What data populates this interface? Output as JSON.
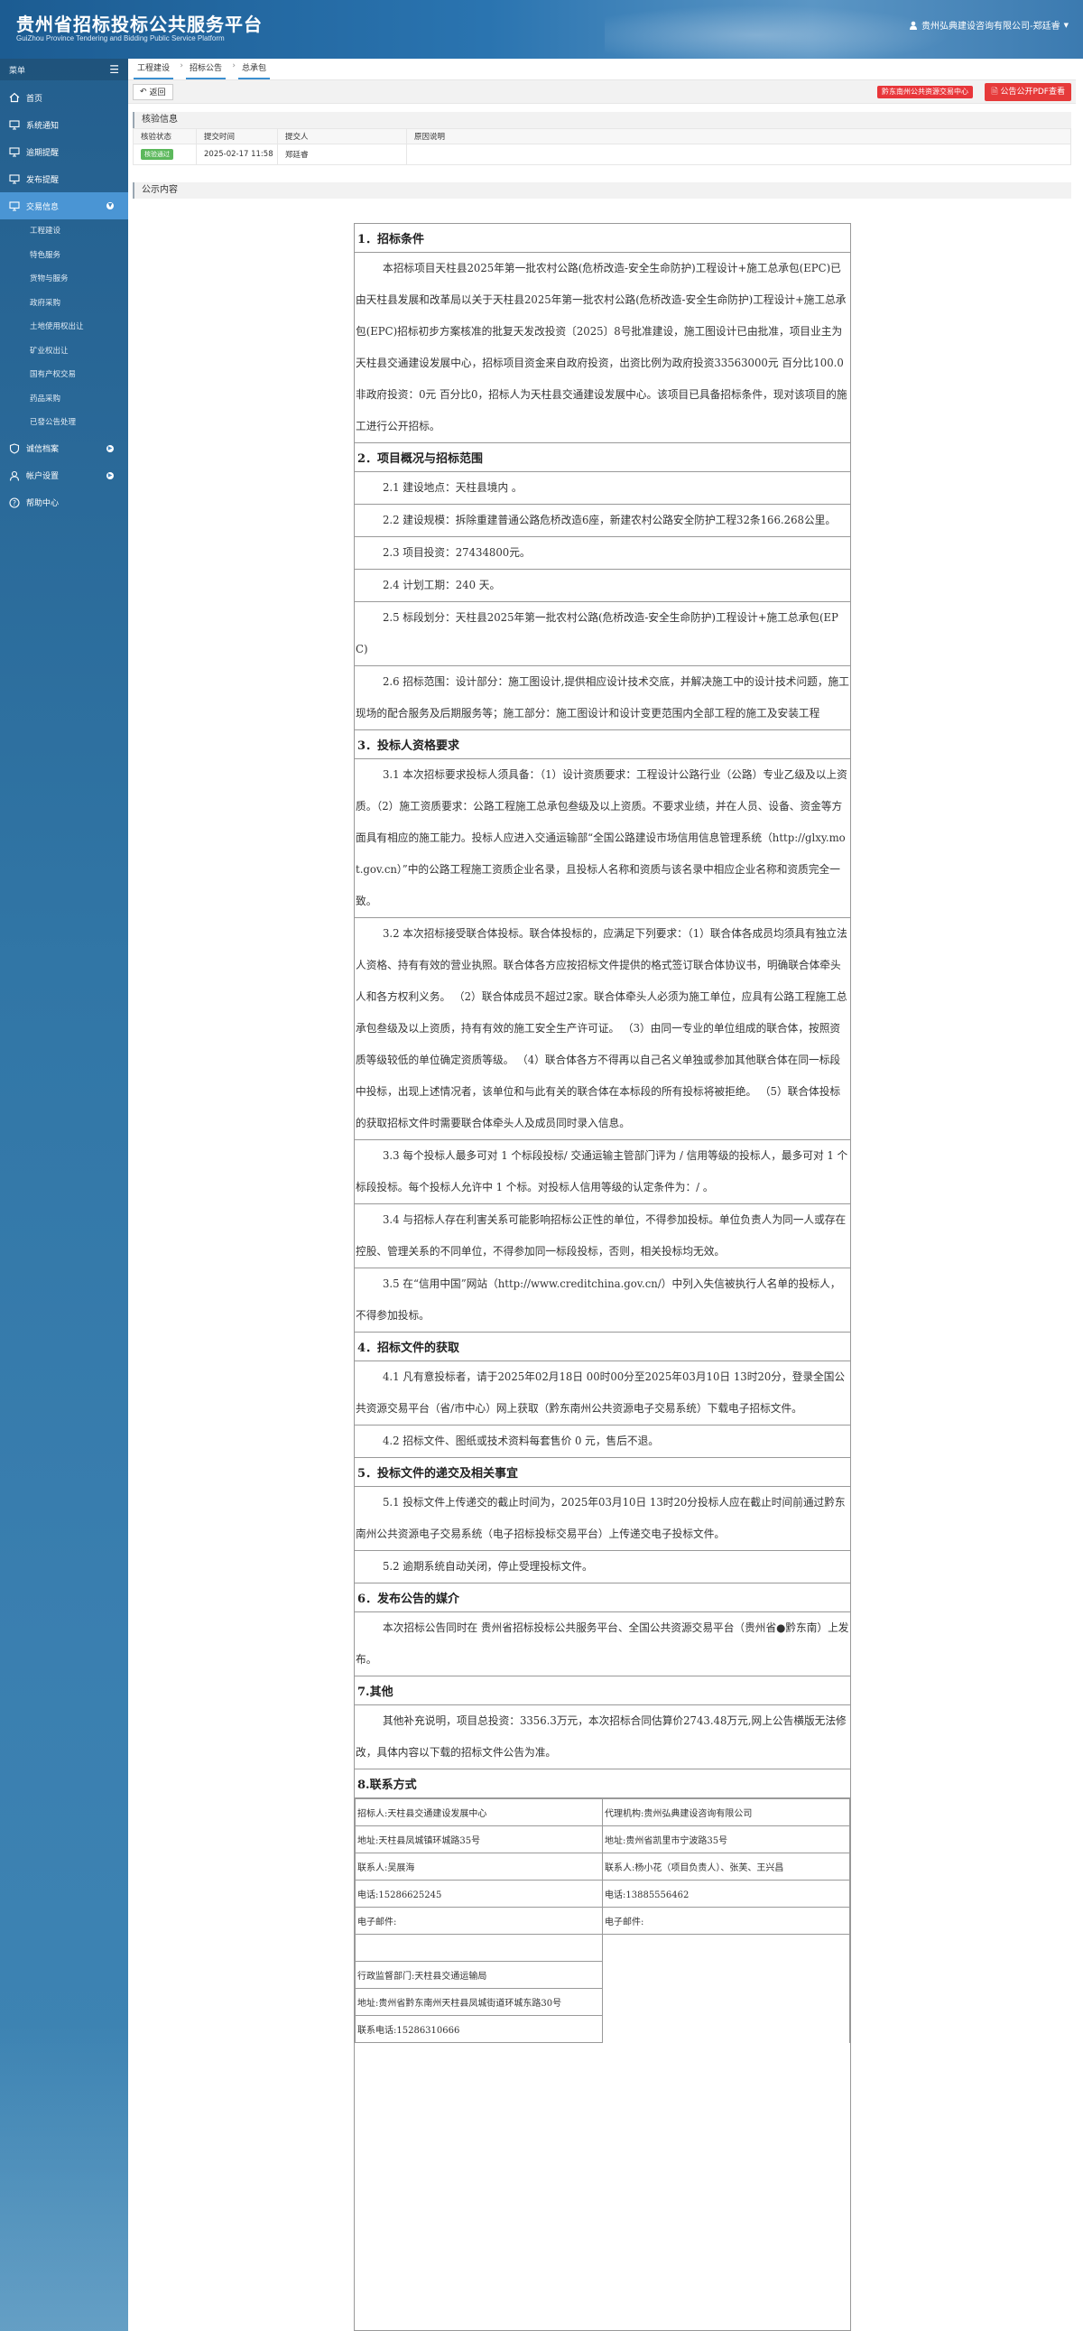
{
  "header": {
    "title": "贵州省招标投标公共服务平台",
    "subtitle": "GuiZhou Province Tendering and Bidding Public Service Platform",
    "user": "贵州弘典建设咨询有限公司-郑廷睿"
  },
  "sidebar": {
    "label": "菜单",
    "items": [
      {
        "label": "首页",
        "icon": "home-icon"
      },
      {
        "label": "系统通知",
        "icon": "monitor-icon"
      },
      {
        "label": "逾期提醒",
        "icon": "monitor-icon"
      },
      {
        "label": "发布提醒",
        "icon": "monitor-icon"
      },
      {
        "label": "交易信息",
        "icon": "monitor-icon"
      }
    ],
    "subitems": [
      "工程建设",
      "特色服务",
      "货物与服务",
      "政府采购",
      "土地使用权出让",
      "矿业权出让",
      "国有产权交易",
      "药品采购",
      "已發公告处理"
    ],
    "items2": [
      {
        "label": "诚信档案",
        "icon": "shield-icon"
      },
      {
        "label": "帐户设置",
        "icon": "user-icon"
      },
      {
        "label": "帮助中心",
        "icon": "help-icon"
      }
    ]
  },
  "breadcrumb": [
    "工程建设",
    "招标公告",
    "总承包"
  ],
  "toolbar": {
    "back": "返回",
    "center_btn": "黔东南州公共资源交易中心",
    "pdf_btn": "公告公开PDF查看"
  },
  "verify": {
    "section": "核验信息",
    "headers": [
      "核验状态",
      "提交时间",
      "提交人",
      "原因说明"
    ],
    "row": {
      "status": "核验通过",
      "time": "2025-02-17 11:58",
      "person": "郑廷睿",
      "reason": ""
    }
  },
  "notice": {
    "section": "公示内容",
    "blocks": [
      {
        "t": "h",
        "text": "1．招标条件"
      },
      {
        "t": "p",
        "text": "本招标项目天柱县2025年第一批农村公路(危桥改造-安全生命防护)工程设计+施工总承包(EPC)已由天柱县发展和改革局以关于天柱县2025年第一批农村公路(危桥改造-安全生命防护)工程设计+施工总承包(EPC)招标初步方案核准的批复天发改投资〔2025〕8号批准建设，施工图设计已由批准，项目业主为天柱县交通建设发展中心，招标项目资金来自政府投资，出资比例为政府投资33563000元 百分比100.0非政府投资：0元 百分比0，招标人为天柱县交通建设发展中心。该项目已具备招标条件，现对该项目的施工进行公开招标。"
      },
      {
        "t": "h",
        "text": "2．项目概况与招标范围"
      },
      {
        "t": "p",
        "text": "2.1 建设地点：天柱县境内 。"
      },
      {
        "t": "p",
        "text": "2.2 建设规模：拆除重建普通公路危桥改造6座，新建农村公路安全防护工程32条166.268公里。"
      },
      {
        "t": "p",
        "text": "2.3 项目投资：27434800元。"
      },
      {
        "t": "p",
        "text": "2.4 计划工期：240 天。"
      },
      {
        "t": "p",
        "text": "2.5 标段划分：天柱县2025年第一批农村公路(危桥改造-安全生命防护)工程设计+施工总承包(EPC)"
      },
      {
        "t": "p",
        "text": "2.6 招标范围：设计部分：施工图设计,提供相应设计技术交底，并解决施工中的设计技术问题，施工现场的配合服务及后期服务等；施工部分：施工图设计和设计变更范围内全部工程的施工及安装工程"
      },
      {
        "t": "h",
        "text": "3．投标人资格要求"
      },
      {
        "t": "p",
        "text": "3.1 本次招标要求投标人须具备：（1）设计资质要求：工程设计公路行业（公路）专业乙级及以上资质。（2）施工资质要求：公路工程施工总承包叁级及以上资质。不要求业绩，并在人员、设备、资金等方面具有相应的施工能力。投标人应进入交通运输部“全国公路建设市场信用信息管理系统（http://glxy.mot.gov.cn）”中的公路工程施工资质企业名录，且投标人名称和资质与该名录中相应企业名称和资质完全一致。"
      },
      {
        "t": "p",
        "text": "3.2 本次招标接受联合体投标。联合体投标的，应满足下列要求：（1）联合体各成员均须具有独立法人资格、持有有效的营业执照。联合体各方应按招标文件提供的格式签订联合体协议书，明确联合体牵头人和各方权利义务。 （2）联合体成员不超过2家。联合体牵头人必须为施工单位，应具有公路工程施工总承包叁级及以上资质，持有有效的施工安全生产许可证。 （3）由同一专业的单位组成的联合体，按照资质等级较低的单位确定资质等级。 （4）联合体各方不得再以自己名义单独或参加其他联合体在同一标段中投标，出现上述情况者，该单位和与此有关的联合体在本标段的所有投标将被拒绝。 （5）联合体投标的获取招标文件时需要联合体牵头人及成员同时录入信息。"
      },
      {
        "t": "p",
        "text": "3.3 每个投标人最多可对 1 个标段投标/ 交通运输主管部门评为 / 信用等级的投标人，最多可对 1 个标段投标。每个投标人允许中  1  个标。对投标人信用等级的认定条件为：/ 。"
      },
      {
        "t": "p",
        "text": "3.4 与招标人存在利害关系可能影响招标公正性的单位，不得参加投标。单位负责人为同一人或存在控股、管理关系的不同单位，不得参加同一标段投标，否则，相关投标均无效。"
      },
      {
        "t": "p",
        "text": "3.5 在“信用中国”网站（http://www.creditchina.gov.cn/）中列入失信被执行人名单的投标人，不得参加投标。"
      },
      {
        "t": "h",
        "text": "4．招标文件的获取"
      },
      {
        "t": "p",
        "text": "4.1 凡有意投标者，请于2025年02月18日 00时00分至2025年03月10日 13时20分，登录全国公共资源交易平台（省/市中心）网上获取（黔东南州公共资源电子交易系统）下载电子招标文件。"
      },
      {
        "t": "p",
        "text": "4.2 招标文件、图纸或技术资料每套售价 0 元，售后不退。"
      },
      {
        "t": "h",
        "text": "5．投标文件的递交及相关事宜"
      },
      {
        "t": "p",
        "text": "5.1 投标文件上传递交的截止时间为，2025年03月10日 13时20分投标人应在截止时间前通过黔东南州公共资源电子交易系统（电子招标投标交易平台）上传递交电子投标文件。"
      },
      {
        "t": "p",
        "text": "5.2 逾期系统自动关闭，停止受理投标文件。"
      },
      {
        "t": "h",
        "text": "6．发布公告的媒介"
      },
      {
        "t": "p",
        "text": "本次招标公告同时在 贵州省招标投标公共服务平台、全国公共资源交易平台（贵州省●黔东南）上发布。"
      },
      {
        "t": "h",
        "text": "7.其他"
      },
      {
        "t": "p",
        "text": "其他补充说明，项目总投资：3356.3万元，本次招标合同估算价2743.48万元,网上公告横版无法修改，具体内容以下载的招标文件公告为准。"
      },
      {
        "t": "h",
        "text": "8.联系方式"
      }
    ],
    "contacts": {
      "left": [
        "招标人:天柱县交通建设发展中心",
        "地址:天柱县凤城镇环城路35号",
        "联系人:吴展海",
        "电话:15286625245",
        "电子邮件:"
      ],
      "right": [
        "代理机构:贵州弘典建设咨询有限公司",
        "地址:贵州省凯里市宁波路35号",
        "联系人:杨小花（项目负责人）、张芙、王兴昌",
        "电话:13885556462",
        "电子邮件:"
      ],
      "supervise": [
        "行政监督部门:天柱县交通运输局",
        "地址:贵州省黔东南州天柱县凤城街道环城东路30号",
        "联系电话:15286310666"
      ]
    }
  }
}
